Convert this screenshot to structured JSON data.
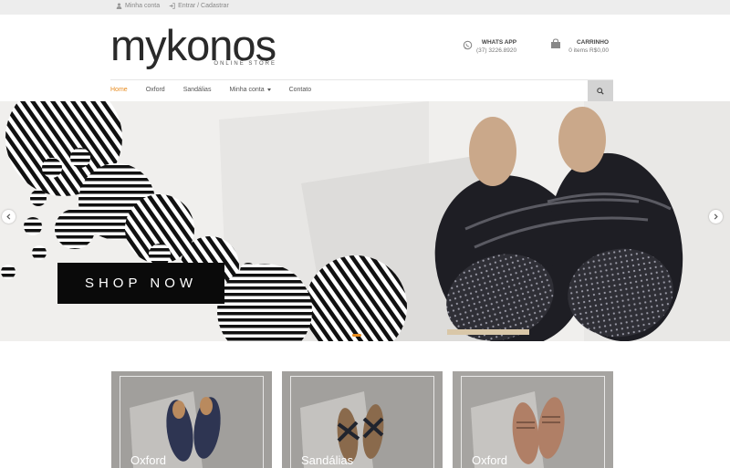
{
  "topbar": {
    "account_label": "Minha conta",
    "login_label": "Entrar / Cadastrar"
  },
  "logo": {
    "word": "mykonos",
    "sub": "ONLINE STORE"
  },
  "whatsapp": {
    "title": "WHATS APP",
    "phone": "(37) 3226.8920"
  },
  "cart": {
    "title": "CARRINHO",
    "summary": "0 items R$0,00"
  },
  "nav": {
    "items": [
      {
        "label": "Home",
        "active": true
      },
      {
        "label": "Oxford",
        "active": false
      },
      {
        "label": "Sandálias",
        "active": false
      },
      {
        "label": "Minha conta",
        "active": false,
        "dropdown": true
      },
      {
        "label": "Contato",
        "active": false
      }
    ]
  },
  "hero": {
    "cta_label": "SHOP NOW",
    "accent_color": "#e88b1e"
  },
  "categories": [
    {
      "label": "Oxford"
    },
    {
      "label": "Sandálias"
    },
    {
      "label": "Oxford"
    }
  ],
  "icons": {
    "account": "user-icon",
    "login": "sign-in-icon",
    "whatsapp": "whatsapp-icon",
    "cart": "shopping-bag-icon",
    "search": "search-icon",
    "prev": "chevron-left-icon",
    "next": "chevron-right-icon"
  }
}
